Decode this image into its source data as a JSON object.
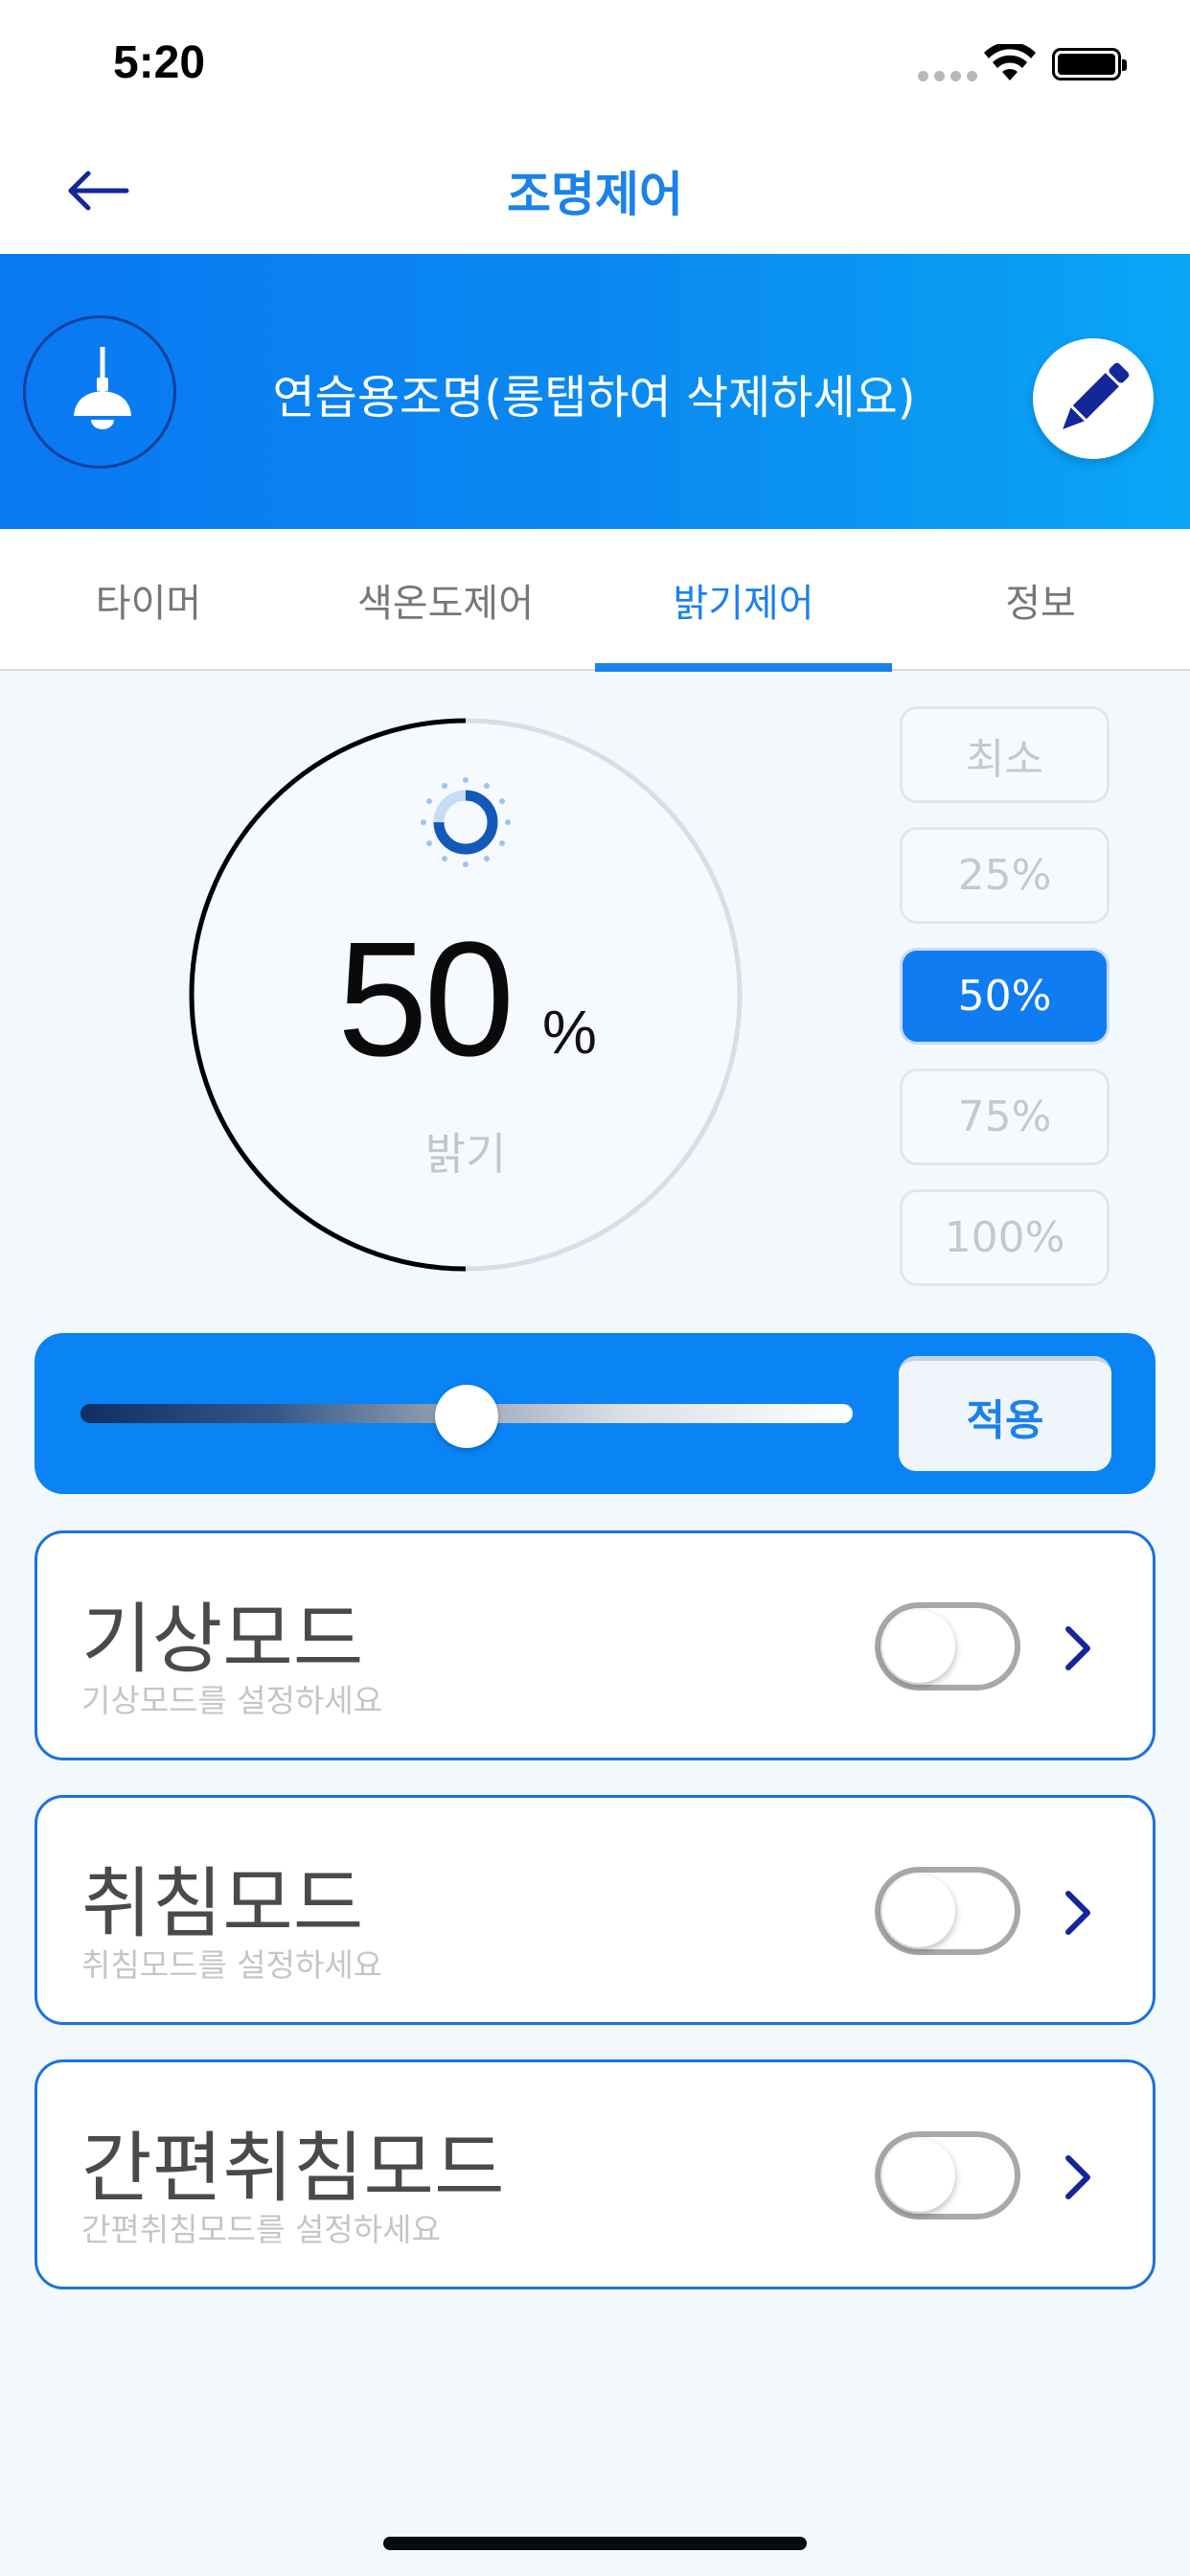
{
  "status_bar": {
    "time": "5:20"
  },
  "nav": {
    "title": "조명제어",
    "back_icon": "arrow-left-icon"
  },
  "device": {
    "name": "연습용조명(롱탭하여 삭제하세요)",
    "icon": "ceiling-lamp-icon",
    "edit_icon": "pencil-icon"
  },
  "tabs": [
    {
      "label": "타이머"
    },
    {
      "label": "색온도제어"
    },
    {
      "label": "밝기제어"
    },
    {
      "label": "정보"
    }
  ],
  "active_tab": "밝기제어",
  "brightness": {
    "value": "50",
    "unit": "%",
    "label": "밝기",
    "level_percent": 50
  },
  "presets": [
    {
      "label": "최소"
    },
    {
      "label": "25%"
    },
    {
      "label": "50%"
    },
    {
      "label": "75%"
    },
    {
      "label": "100%"
    }
  ],
  "selected_preset": "50%",
  "slider": {
    "apply_label": "적용",
    "level_percent": 50
  },
  "modes": [
    {
      "title": "기상모드",
      "subtitle": "기상모드를 설정하세요",
      "enabled": false
    },
    {
      "title": "취침모드",
      "subtitle": "취침모드를 설정하세요",
      "enabled": false
    },
    {
      "title": "간편취침모드",
      "subtitle": "간편취침모드를 설정하세요",
      "enabled": false
    }
  ],
  "colors": {
    "accent": "#1a82ea",
    "header_gradient_start": "#0a78f2",
    "header_gradient_end": "#0aa6f6",
    "card_border": "#1a72e0",
    "chevron": "#13269a"
  }
}
